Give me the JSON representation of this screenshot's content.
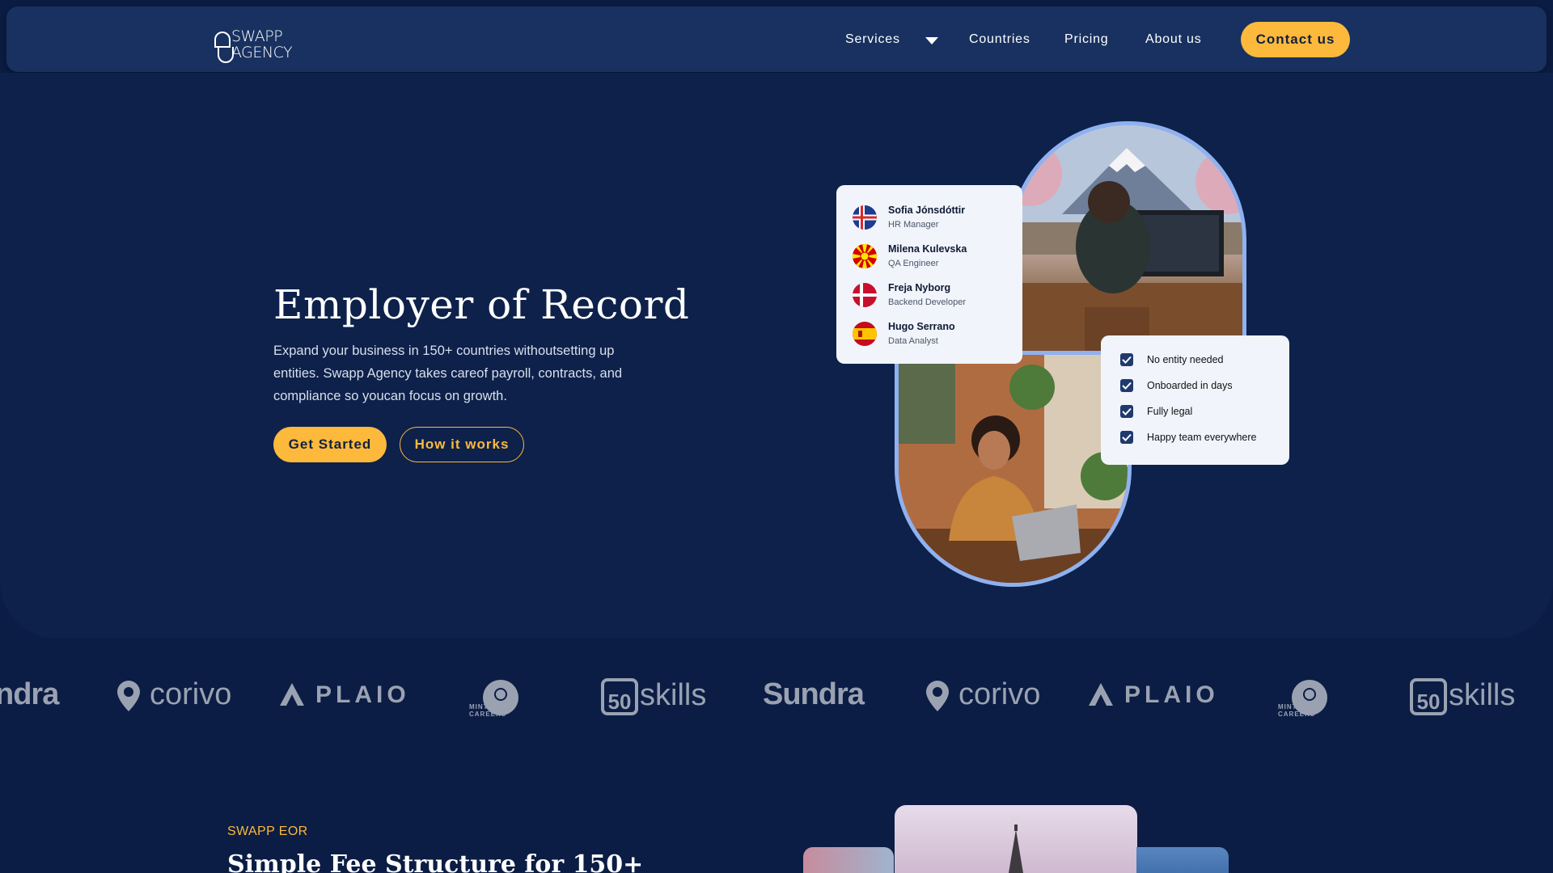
{
  "nav": {
    "logo_line1": "SWAPP",
    "logo_line2": "AGENCY",
    "items": [
      "Services",
      "Countries",
      "Pricing",
      "About us"
    ],
    "contact_label": "Contact us"
  },
  "hero": {
    "title": "Employer of Record",
    "description": "Expand your business in 150+ countries withoutsetting up entities. Swapp Agency takes careof payroll, contracts, and compliance so youcan focus on growth.",
    "primary_label": "Get Started",
    "secondary_label": "How it works"
  },
  "people": [
    {
      "name": "Sofia Jónsdóttir",
      "role": "HR Manager",
      "flag": "iceland-flag"
    },
    {
      "name": "Milena Kulevska",
      "role": "QA Engineer",
      "flag": "north-macedonia-flag"
    },
    {
      "name": "Freja Nyborg",
      "role": "Backend Developer",
      "flag": "denmark-flag"
    },
    {
      "name": "Hugo Serrano",
      "role": "Data Analyst",
      "flag": "spain-flag"
    }
  ],
  "checklist": [
    "No entity needed",
    "Onboarded in days",
    "Fully legal",
    "Happy team everywhere"
  ],
  "brands": [
    "ndra",
    "corivo",
    "PLAIO",
    "MINT CAREERS",
    "skills",
    "Sundra",
    "corivo",
    "PLAIO",
    "MINT CAREERS",
    "skills"
  ],
  "section2": {
    "eyebrow": "SWAPP EOR",
    "title": "Simple Fee Structure for 150+"
  },
  "colors": {
    "accent": "#fdb93c",
    "background": "#0b1d44",
    "nav": "#183160",
    "card": "#f1f4fb"
  }
}
